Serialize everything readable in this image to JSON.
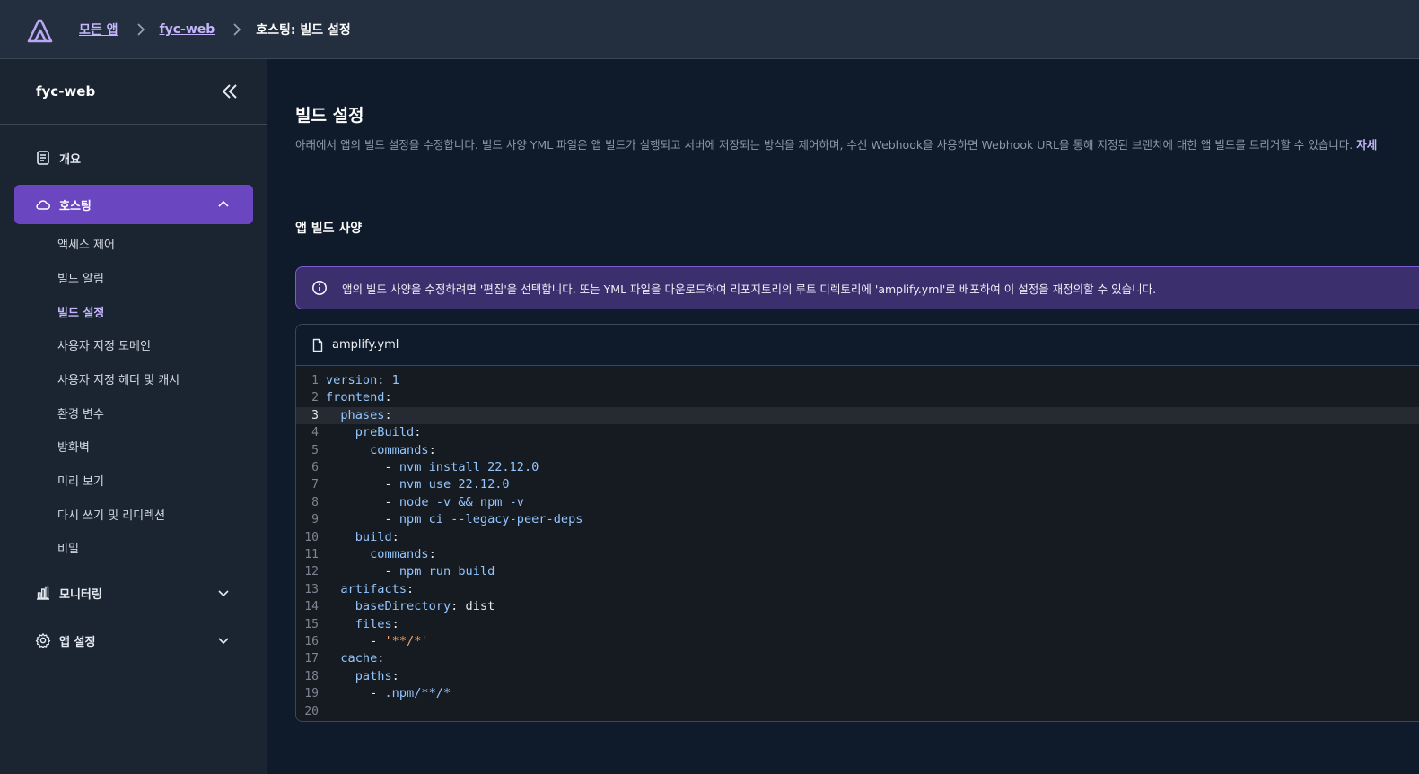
{
  "topbar": {
    "logo_icon": "amplify-logo-icon",
    "breadcrumbs": [
      {
        "label": "모든 앱"
      },
      {
        "label": "fyc-web"
      }
    ],
    "current": "호스팅: 빌드 설정"
  },
  "sidebar": {
    "title": "fyc-web",
    "collapse_icon": "double-chevron-left-icon",
    "overview": {
      "label": "개요",
      "icon": "document-icon"
    },
    "hosting": {
      "label": "호스팅",
      "icon": "cloud-icon",
      "expanded": true
    },
    "hosting_items": [
      {
        "label": "액세스 제어"
      },
      {
        "label": "빌드 알림"
      },
      {
        "label": "빌드 설정",
        "selected": true
      },
      {
        "label": "사용자 지정 도메인"
      },
      {
        "label": "사용자 지정 헤더 및 캐시"
      },
      {
        "label": "환경 변수"
      },
      {
        "label": "방화벽"
      },
      {
        "label": "미리 보기"
      },
      {
        "label": "다시 쓰기 및 리디렉션"
      },
      {
        "label": "비밀"
      }
    ],
    "monitoring": {
      "label": "모니터링",
      "icon": "bar-chart-icon"
    },
    "app_settings": {
      "label": "앱 설정",
      "icon": "gear-icon"
    }
  },
  "main": {
    "title": "빌드 설정",
    "description": "아래에서 앱의 빌드 설정을 수정합니다. 빌드 사양 YML 파일은 앱 빌드가 실행되고 서버에 저장되는 방식을 제어하며, 수신 Webhook을 사용하면 Webhook URL을 통해 지정된 브랜치에 대한 앱 빌드를 트리거할 수 있습니다.",
    "learn_more": "자세",
    "section_title": "앱 빌드 사양",
    "alert": {
      "icon": "info-icon",
      "text": "앱의 빌드 사양을 수정하려면 '편집'을 선택합니다. 또는 YML 파일을 다운로드하여 리포지토리의 루트 디렉토리에 'amplify.yml'로 배포하여 이 설정을 재정의할 수 있습니다."
    },
    "file": {
      "icon": "file-icon",
      "name": "amplify.yml",
      "current_line": 3,
      "lines": [
        "version: 1",
        "frontend:",
        "  phases:",
        "    preBuild:",
        "      commands:",
        "        - nvm install 22.12.0",
        "        - nvm use 22.12.0",
        "        - node -v && npm -v",
        "        - npm ci --legacy-peer-deps",
        "    build:",
        "      commands:",
        "        - npm run build",
        "  artifacts:",
        "    baseDirectory: dist",
        "    files:",
        "      - '**/*'",
        "  cache:",
        "    paths:",
        "      - .npm/**/*",
        ""
      ]
    }
  },
  "colors": {
    "accent": "#6b46c1",
    "link": "#c4b5fd",
    "alert_bg": "#3b2f6e",
    "yaml_key": "#93c5fd",
    "yaml_string": "#f0a56b"
  }
}
